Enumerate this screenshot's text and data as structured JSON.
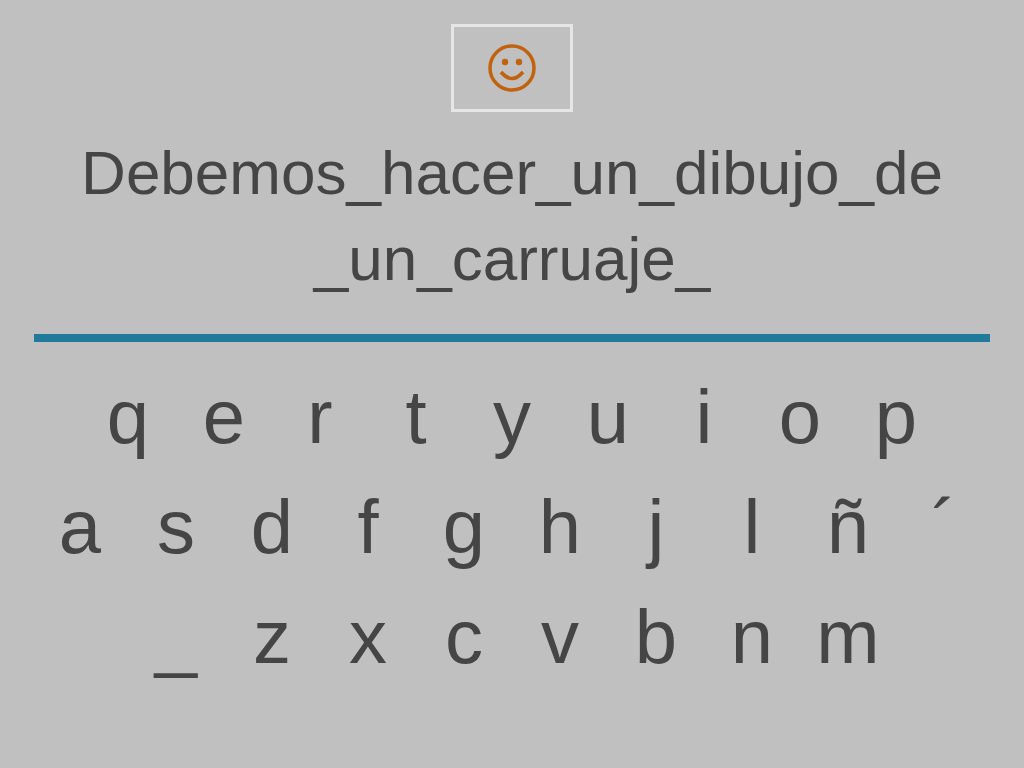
{
  "sentence": "Debemos_hacer_un_dibujo_de_un_carruaje_",
  "keyboard_rows": [
    [
      "q",
      "e",
      "r",
      "t",
      "y",
      "u",
      "i",
      "o",
      "p"
    ],
    [
      "a",
      "s",
      "d",
      "f",
      "g",
      "h",
      "j",
      "l",
      "ñ",
      "´"
    ],
    [
      "_",
      "z",
      "x",
      "c",
      "v",
      "b",
      "n",
      "m"
    ]
  ]
}
